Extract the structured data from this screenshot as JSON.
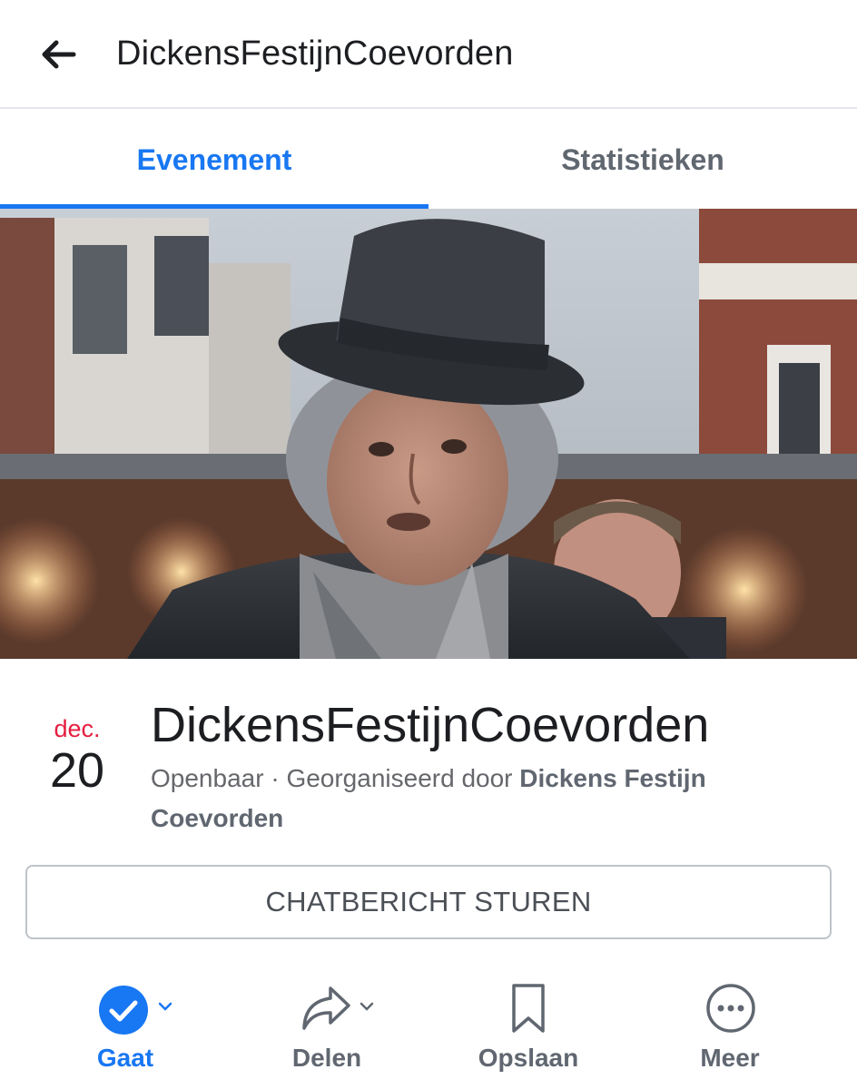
{
  "header": {
    "back_icon": "arrow-left-icon",
    "title": "DickensFestijnCoevorden"
  },
  "tabs": [
    {
      "label": "Evenement",
      "active": true
    },
    {
      "label": "Statistieken",
      "active": false
    }
  ],
  "colors": {
    "accent": "#1877f2",
    "date_month": "#e41e3f",
    "muted_text": "#65676b"
  },
  "event": {
    "month": "dec.",
    "day": "20",
    "title": "DickensFestijnCoevorden",
    "visibility": "Openbaar",
    "organized_prefix": "Georganiseerd door",
    "organizer": "Dickens Festijn Coevorden"
  },
  "chat_button": {
    "label": "CHATBERICHT STUREN"
  },
  "actions": [
    {
      "label": "Gaat",
      "icon": "check-circle-icon",
      "dropdown": true
    },
    {
      "label": "Delen",
      "icon": "share-arrow-icon",
      "dropdown": true
    },
    {
      "label": "Opslaan",
      "icon": "bookmark-icon",
      "dropdown": false
    },
    {
      "label": "Meer",
      "icon": "more-dots-icon",
      "dropdown": false
    }
  ]
}
